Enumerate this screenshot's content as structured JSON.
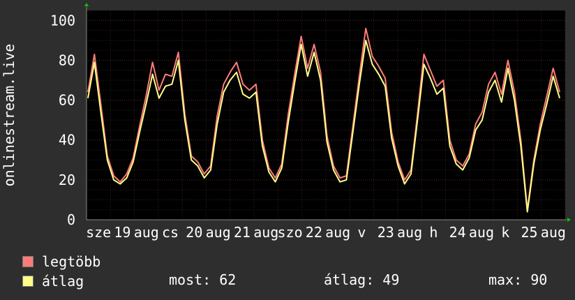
{
  "chart_data": {
    "type": "line",
    "ylabel": "onlinestream.live",
    "ylim": [
      0,
      105
    ],
    "y_ticks": [
      0,
      20,
      40,
      60,
      80,
      100
    ],
    "x_tick_labels": [
      "sze",
      "19",
      "aug",
      "cs",
      "20",
      "aug",
      "21",
      "aug",
      "szo",
      "22",
      "aug",
      "v",
      "23",
      "aug",
      "h",
      "24",
      "aug",
      "k",
      "25",
      "aug"
    ],
    "grid": true,
    "background": "#000000",
    "series": [
      {
        "name": "legtöbb",
        "color": "#ff7b7b",
        "values": [
          64,
          83,
          58,
          32,
          22,
          19,
          23,
          31,
          47,
          62,
          79,
          65,
          73,
          72,
          84,
          53,
          32,
          29,
          23,
          27,
          52,
          68,
          74,
          79,
          68,
          65,
          68,
          40,
          26,
          21,
          28,
          53,
          73,
          92,
          76,
          88,
          74,
          42,
          27,
          21,
          22,
          47,
          72,
          96,
          82,
          77,
          71,
          44,
          29,
          20,
          25,
          53,
          83,
          75,
          67,
          70,
          40,
          30,
          27,
          33,
          48,
          54,
          68,
          74,
          63,
          80,
          64,
          40,
          5,
          30,
          48,
          62,
          76,
          64
        ]
      },
      {
        "name": "átlag",
        "color": "#ffff88",
        "values": [
          61,
          79,
          54,
          30,
          20,
          18,
          21,
          29,
          44,
          58,
          73,
          61,
          67,
          68,
          80,
          50,
          30,
          27,
          21,
          25,
          48,
          64,
          70,
          74,
          63,
          61,
          64,
          37,
          24,
          19,
          26,
          49,
          69,
          88,
          72,
          84,
          70,
          39,
          25,
          19,
          20,
          44,
          68,
          90,
          78,
          73,
          67,
          41,
          27,
          18,
          23,
          50,
          78,
          71,
          63,
          66,
          37,
          28,
          25,
          31,
          45,
          50,
          64,
          70,
          59,
          76,
          60,
          37,
          4,
          28,
          45,
          58,
          72,
          61
        ]
      }
    ]
  },
  "legend": [
    {
      "label": "legtöbb",
      "color": "#ff7b7b"
    },
    {
      "label": "átlag",
      "color": "#ffff88"
    }
  ],
  "stats": {
    "now": "most: 62",
    "avg": "átlag: 49",
    "max": "max: 90"
  }
}
